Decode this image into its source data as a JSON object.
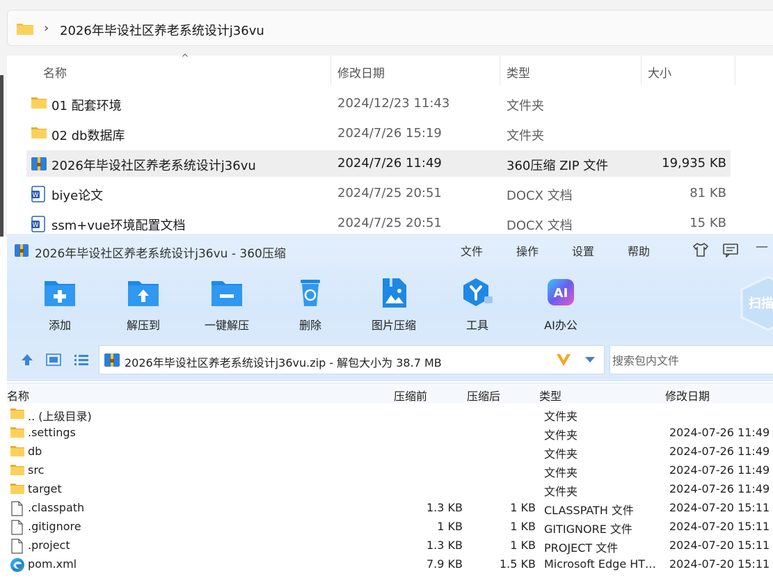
{
  "explorer": {
    "path": "2026年毕设社区养老系统设计j36vu",
    "columns": {
      "name": "名称",
      "modified": "修改日期",
      "type": "类型",
      "size": "大小"
    },
    "rows": [
      {
        "name": "01 配套环境",
        "modified": "2024/12/23 11:43",
        "type": "文件夹",
        "size": "",
        "icon": "folder-icon"
      },
      {
        "name": "02 db数据库",
        "modified": "2024/7/26 15:19",
        "type": "文件夹",
        "size": "",
        "icon": "folder-icon"
      },
      {
        "name": "2026年毕设社区养老系统设计j36vu",
        "modified": "2024/7/26 11:49",
        "type": "360压缩 ZIP 文件",
        "size": "19,935 KB",
        "icon": "zip-archive-icon",
        "selected": true
      },
      {
        "name": "biye论文",
        "modified": "2024/7/25 20:51",
        "type": "DOCX 文档",
        "size": "81 KB",
        "icon": "word-doc-icon"
      },
      {
        "name": "ssm+vue环境配置文档",
        "modified": "2024/7/25 20:51",
        "type": "DOCX 文档",
        "size": "15 KB",
        "icon": "word-doc-icon"
      }
    ]
  },
  "zip": {
    "title": "2026年毕设社区养老系统设计j36vu - 360压缩",
    "menu": [
      "文件",
      "操作",
      "设置",
      "帮助"
    ],
    "toolbar": [
      {
        "label": "添加",
        "icon": "add-folder-icon"
      },
      {
        "label": "解压到",
        "icon": "extract-to-icon"
      },
      {
        "label": "一键解压",
        "icon": "one-click-extract-icon"
      },
      {
        "label": "删除",
        "icon": "trash-icon"
      },
      {
        "label": "图片压缩",
        "icon": "image-compress-icon"
      },
      {
        "label": "工具",
        "icon": "tools-icon"
      },
      {
        "label": "AI办公",
        "icon": "ai-office-icon"
      }
    ],
    "side_badge": "扫描",
    "path_text": "2026年毕设社区养老系统设计j36vu.zip - 解包大小为 38.7 MB",
    "search_placeholder": "搜索包内文件",
    "columns": {
      "name": "名称",
      "before": "压缩前",
      "after": "压缩后",
      "type": "类型",
      "modified": "修改日期"
    },
    "rows": [
      {
        "name": ".. (上级目录)",
        "before": "",
        "after": "",
        "type": "文件夹",
        "modified": "",
        "icon": "folder-icon"
      },
      {
        "name": ".settings",
        "before": "",
        "after": "",
        "type": "文件夹",
        "modified": "2024-07-26 11:49",
        "icon": "folder-icon"
      },
      {
        "name": "db",
        "before": "",
        "after": "",
        "type": "文件夹",
        "modified": "2024-07-26 11:49",
        "icon": "folder-icon"
      },
      {
        "name": "src",
        "before": "",
        "after": "",
        "type": "文件夹",
        "modified": "2024-07-26 11:49",
        "icon": "folder-icon"
      },
      {
        "name": "target",
        "before": "",
        "after": "",
        "type": "文件夹",
        "modified": "2024-07-26 11:49",
        "icon": "folder-icon"
      },
      {
        "name": ".classpath",
        "before": "1.3 KB",
        "after": "1 KB",
        "type": "CLASSPATH 文件",
        "modified": "2024-07-20 15:11",
        "icon": "file-icon"
      },
      {
        "name": ".gitignore",
        "before": "1 KB",
        "after": "1 KB",
        "type": "GITIGNORE 文件",
        "modified": "2024-07-20 15:11",
        "icon": "file-icon"
      },
      {
        "name": ".project",
        "before": "1.3 KB",
        "after": "1 KB",
        "type": "PROJECT 文件",
        "modified": "2024-07-20 15:11",
        "icon": "file-icon"
      },
      {
        "name": "pom.xml",
        "before": "7.9 KB",
        "after": "1.5 KB",
        "type": "Microsoft Edge HT…",
        "modified": "2024-07-20 15:11",
        "icon": "edge-icon"
      }
    ]
  },
  "colors": {
    "accent": "#1e88e5",
    "selection": "#eeeeee",
    "zip_header": "#d6e8fb",
    "folder": "#f5c242"
  }
}
